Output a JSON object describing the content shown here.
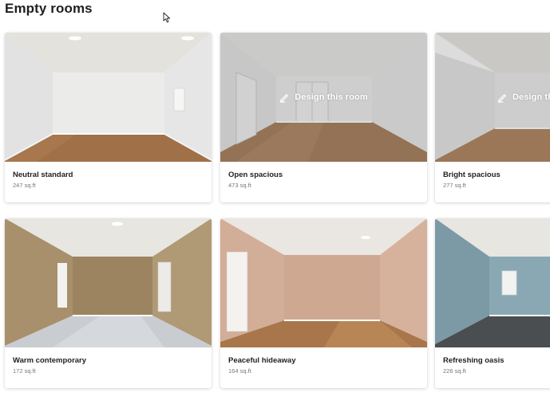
{
  "section": {
    "title": "Empty rooms"
  },
  "rooms": [
    {
      "name": "Neutral standard",
      "size": "247 sq.ft",
      "overlay": ""
    },
    {
      "name": "Open spacious",
      "size": "473 sq.ft",
      "overlay": "Design this room"
    },
    {
      "name": "Bright spacious",
      "size": "277 sq.ft",
      "overlay": "Design this room"
    },
    {
      "name": "Warm contemporary",
      "size": "172 sq.ft",
      "overlay": ""
    },
    {
      "name": "Peaceful hideaway",
      "size": "164 sq.ft",
      "overlay": ""
    },
    {
      "name": "Refreshing oasis",
      "size": "226 sq.ft",
      "overlay": ""
    }
  ],
  "icons": {
    "cursor": "mouse-pointer-icon",
    "design": "pencil-icon"
  },
  "colors": {
    "title": "#1f1f1f",
    "overlay_text": "#ffffff",
    "size_text": "#777777"
  }
}
